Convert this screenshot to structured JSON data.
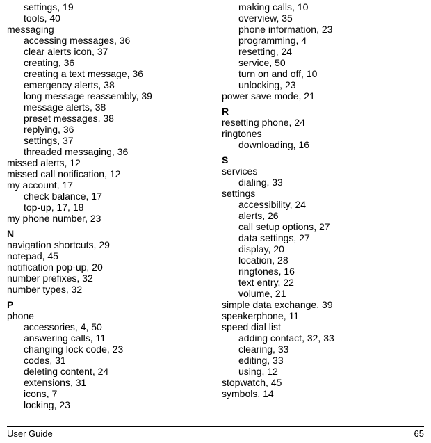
{
  "footer": {
    "left": "User Guide",
    "right": "65"
  },
  "left_items": [
    {
      "t": "sub",
      "label": "settings",
      "pages": "19"
    },
    {
      "t": "sub",
      "label": "tools",
      "pages": "40"
    },
    {
      "t": "head",
      "label": "messaging"
    },
    {
      "t": "sub",
      "label": "accessing messages",
      "pages": "36"
    },
    {
      "t": "sub",
      "label": "clear alerts icon",
      "pages": "37"
    },
    {
      "t": "sub",
      "label": "creating",
      "pages": "36"
    },
    {
      "t": "sub",
      "label": "creating a text message",
      "pages": "36"
    },
    {
      "t": "sub",
      "label": "emergency alerts",
      "pages": "38"
    },
    {
      "t": "sub",
      "label": "long message reassembly",
      "pages": "39"
    },
    {
      "t": "sub",
      "label": "message alerts",
      "pages": "38"
    },
    {
      "t": "sub",
      "label": "preset messages",
      "pages": "38"
    },
    {
      "t": "sub",
      "label": "replying",
      "pages": "36"
    },
    {
      "t": "sub",
      "label": "settings",
      "pages": "37"
    },
    {
      "t": "sub",
      "label": "threaded messaging",
      "pages": "36"
    },
    {
      "t": "entry",
      "label": "missed alerts",
      "pages": "12"
    },
    {
      "t": "entry",
      "label": "missed call notification",
      "pages": "12"
    },
    {
      "t": "entry",
      "label": "my account",
      "pages": "17"
    },
    {
      "t": "sub",
      "label": "check balance",
      "pages": "17"
    },
    {
      "t": "sub",
      "label": "top-up",
      "pages": "17, 18"
    },
    {
      "t": "entry",
      "label": "my phone number",
      "pages": "23"
    },
    {
      "t": "letter",
      "label": "N"
    },
    {
      "t": "entry",
      "label": "navigation shortcuts",
      "pages": "29"
    },
    {
      "t": "entry",
      "label": "notepad",
      "pages": "45"
    },
    {
      "t": "entry",
      "label": "notification pop-up",
      "pages": "20"
    },
    {
      "t": "entry",
      "label": "number prefixes",
      "pages": "32"
    },
    {
      "t": "entry",
      "label": "number types",
      "pages": "32"
    },
    {
      "t": "letter",
      "label": "P"
    },
    {
      "t": "head",
      "label": "phone"
    },
    {
      "t": "sub",
      "label": "accessories",
      "pages": "4, 50"
    },
    {
      "t": "sub",
      "label": "answering calls",
      "pages": "11"
    },
    {
      "t": "sub",
      "label": "changing lock code",
      "pages": "23"
    },
    {
      "t": "sub",
      "label": "codes",
      "pages": "31"
    },
    {
      "t": "sub",
      "label": "deleting content",
      "pages": "24"
    },
    {
      "t": "sub",
      "label": "extensions",
      "pages": "31"
    },
    {
      "t": "sub",
      "label": "icons",
      "pages": "7"
    },
    {
      "t": "sub",
      "label": "locking",
      "pages": "23"
    }
  ],
  "right_items": [
    {
      "t": "sub",
      "label": "making calls",
      "pages": "10"
    },
    {
      "t": "sub",
      "label": "overview",
      "pages": "35"
    },
    {
      "t": "sub",
      "label": "phone information",
      "pages": "23"
    },
    {
      "t": "sub",
      "label": "programming",
      "pages": "4"
    },
    {
      "t": "sub",
      "label": "resetting",
      "pages": "24"
    },
    {
      "t": "sub",
      "label": "service",
      "pages": "50"
    },
    {
      "t": "sub",
      "label": "turn on and off",
      "pages": "10"
    },
    {
      "t": "sub",
      "label": "unlocking",
      "pages": "23"
    },
    {
      "t": "entry",
      "label": "power save mode",
      "pages": "21"
    },
    {
      "t": "letter",
      "label": "R"
    },
    {
      "t": "entry",
      "label": "resetting phone",
      "pages": "24"
    },
    {
      "t": "head",
      "label": "ringtones"
    },
    {
      "t": "sub",
      "label": "downloading",
      "pages": "16"
    },
    {
      "t": "letter",
      "label": "S"
    },
    {
      "t": "head",
      "label": "services"
    },
    {
      "t": "sub",
      "label": "dialing",
      "pages": "33"
    },
    {
      "t": "head",
      "label": "settings"
    },
    {
      "t": "sub",
      "label": "accessibility",
      "pages": "24"
    },
    {
      "t": "sub",
      "label": "alerts",
      "pages": "26"
    },
    {
      "t": "sub",
      "label": "call setup options",
      "pages": "27"
    },
    {
      "t": "sub",
      "label": "data settings",
      "pages": "27"
    },
    {
      "t": "sub",
      "label": "display",
      "pages": "20"
    },
    {
      "t": "sub",
      "label": "location",
      "pages": "28"
    },
    {
      "t": "sub",
      "label": "ringtones",
      "pages": "16"
    },
    {
      "t": "sub",
      "label": "text entry",
      "pages": "22"
    },
    {
      "t": "sub",
      "label": "volume",
      "pages": "21"
    },
    {
      "t": "entry",
      "label": "simple data exchange",
      "pages": "39"
    },
    {
      "t": "entry",
      "label": "speakerphone",
      "pages": "11"
    },
    {
      "t": "head",
      "label": "speed dial list"
    },
    {
      "t": "sub",
      "label": "adding contact",
      "pages": "32, 33"
    },
    {
      "t": "sub",
      "label": "clearing",
      "pages": "33"
    },
    {
      "t": "sub",
      "label": "editing",
      "pages": "33"
    },
    {
      "t": "sub",
      "label": "using",
      "pages": "12"
    },
    {
      "t": "entry",
      "label": "stopwatch",
      "pages": "45"
    },
    {
      "t": "entry",
      "label": "symbols",
      "pages": "14"
    }
  ]
}
